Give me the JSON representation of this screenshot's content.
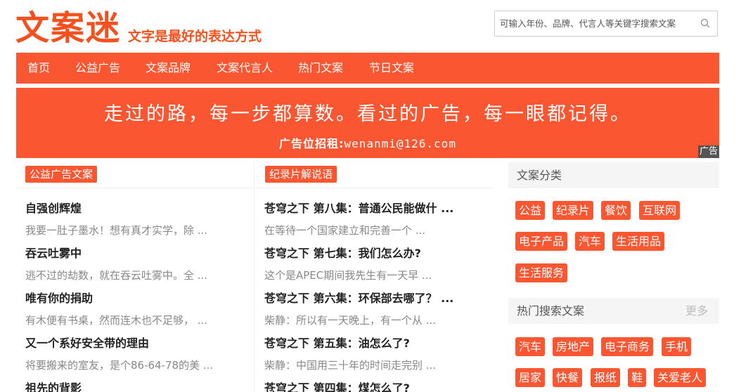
{
  "site": {
    "logo": "文案迷",
    "tagline": "文字是最好的表达方式"
  },
  "search": {
    "placeholder": "可输入年份、品牌、代言人等关键字搜索文案",
    "icon": "search-icon"
  },
  "nav": {
    "items": [
      {
        "label": "首页"
      },
      {
        "label": "公益广告"
      },
      {
        "label": "文案品牌"
      },
      {
        "label": "文案代言人"
      },
      {
        "label": "热门文案"
      },
      {
        "label": "节日文案"
      }
    ]
  },
  "banner": {
    "main": "走过的路，每一步都算数。看过的广告，每一眼都记得。",
    "sub_label": "广告位招租:",
    "sub_email": "wenanmi@126.com",
    "ad_tag": "广告"
  },
  "col1": {
    "heading": "公益广告文案",
    "items": [
      {
        "title": "自强创辉煌",
        "desc": "我要一肚子墨水！想有真才实学，除 ..."
      },
      {
        "title": "吞云吐雾中",
        "desc": "逃不过的劫数，就在吞云吐雾中。全 ..."
      },
      {
        "title": "唯有你的捐助",
        "desc": "有木便有书桌，然而连木也不足够，  ..."
      },
      {
        "title": "又一个系好安全带的理由",
        "desc": "将要搬来的室友，是个86-64-78的美 ..."
      },
      {
        "title": "祖先的背影",
        "desc": ""
      }
    ]
  },
  "col2": {
    "heading": "纪录片解说语",
    "items": [
      {
        "title": "苍穹之下 第八集：普通公民能做什 ...",
        "desc": "在等待一个国家建立和完善一个 ..."
      },
      {
        "title": "苍穹之下 第七集：我们怎么办?",
        "desc": "这个是APEC期间我先生有一天早 ..."
      },
      {
        "title": "苍穹之下 第六集：环保部去哪了？ ...",
        "desc": "柴静：所以有一天晚上，有一个从 ..."
      },
      {
        "title": "苍穹之下 第五集：油怎么了?",
        "desc": "柴静：中国用三十年的时间走完别 ..."
      },
      {
        "title": "苍穹之下 第四集：煤怎么了?",
        "desc": ""
      }
    ]
  },
  "sidebar": {
    "categories_title": "文案分类",
    "categories": [
      "公益",
      "纪录片",
      "餐饮",
      "互联网",
      "电子产品",
      "汽车",
      "生活用品",
      "生活服务"
    ],
    "hot_title": "热门搜索文案",
    "hot_more": "更多",
    "hot_tags": [
      "汽车",
      "房地产",
      "电子商务",
      "手机",
      "居家",
      "快餐",
      "报纸",
      "鞋",
      "关爱老人"
    ]
  },
  "colors": {
    "accent": "#fa5631",
    "logo": "#f4511e"
  }
}
